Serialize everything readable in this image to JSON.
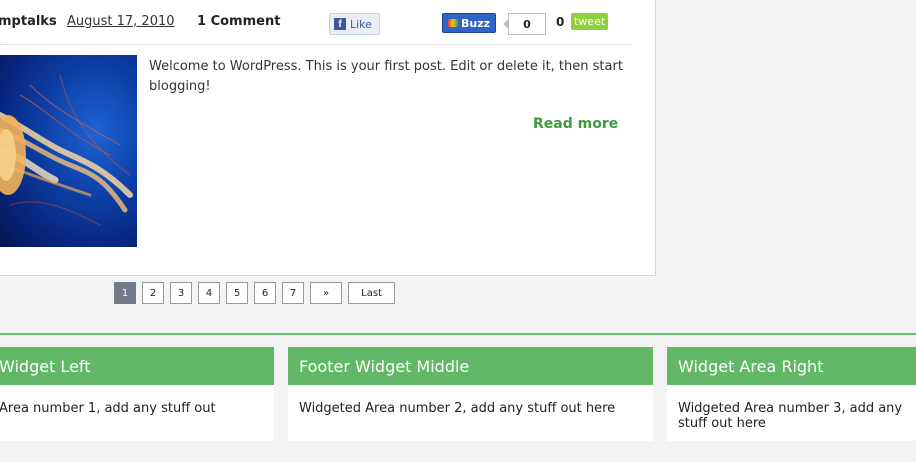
{
  "post": {
    "author": "mptalks",
    "date": "August 17, 2010",
    "comments": "1 Comment",
    "excerpt": "Welcome to WordPress. This is your first post. Edit or delete it, then start blogging!",
    "read_more": "Read more",
    "thumbnail_icon": "jellyfish-image"
  },
  "share": {
    "fb_icon": "f",
    "fb_like": "Like",
    "buzz_label": "Buzz",
    "buzz_count": "0",
    "tweet_count": "0",
    "tweet_label": "tweet"
  },
  "pagination": {
    "pages": [
      "1",
      "2",
      "3",
      "4",
      "5",
      "6",
      "7"
    ],
    "current": "1",
    "next": "»",
    "last": "Last"
  },
  "footer": {
    "widgets": [
      {
        "title": "Widget Left",
        "body": "Area number 1, add any stuff out"
      },
      {
        "title": "Footer Widget Middle",
        "body": "Widgeted Area number 2, add any stuff out here"
      },
      {
        "title": "Widget Area Right",
        "body": "Widgeted Area number 3, add any stuff out here"
      }
    ]
  },
  "colors": {
    "accent_green": "#62b867",
    "read_more_green": "#3f9a3a",
    "pager_current": "#707a89",
    "facebook_blue": "#3b5998",
    "buzz_blue": "#2f63c8",
    "tweet_green": "#8ed13c"
  }
}
